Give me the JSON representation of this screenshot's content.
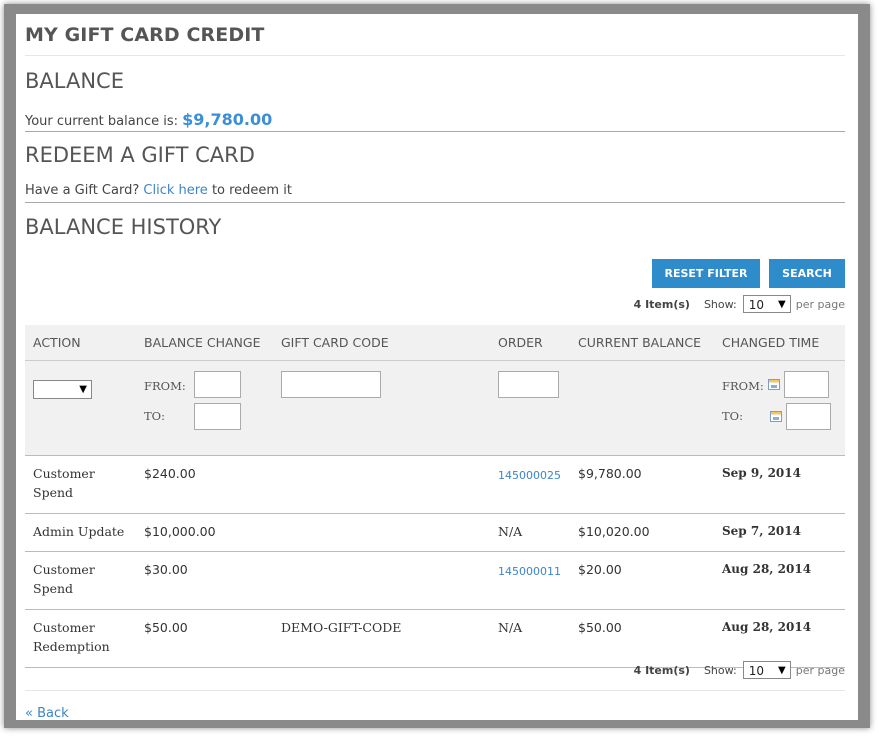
{
  "page_title": "MY GIFT CARD CREDIT",
  "balance": {
    "heading": "BALANCE",
    "text": "Your current balance is:",
    "amount": "$9,780.00"
  },
  "redeem": {
    "heading": "REDEEM A GIFT CARD",
    "prefix": "Have a Gift Card?",
    "link": "Click here",
    "suffix": "to redeem it"
  },
  "history": {
    "heading": "BALANCE HISTORY",
    "reset_filter": "RESET FILTER",
    "search": "SEARCH",
    "items_count": "4 Item(s)",
    "show_label": "Show:",
    "per_page_value": "10",
    "per_page_label": "per page",
    "columns": [
      "ACTION",
      "BALANCE CHANGE",
      "GIFT CARD CODE",
      "ORDER",
      "CURRENT BALANCE",
      "CHANGED TIME"
    ],
    "filters": {
      "from": "FROM:",
      "to": "TO:"
    },
    "rows": [
      {
        "action_line1": "Customer",
        "action_line2": "Spend",
        "change": "$240.00",
        "code": "",
        "order": "145000025",
        "order_is_link": true,
        "current": "$9,780.00",
        "time": "Sep 9, 2014"
      },
      {
        "action_line1": "Admin Update",
        "action_line2": "",
        "change": "$10,000.00",
        "code": "",
        "order": "N/A",
        "order_is_link": false,
        "current": "$10,020.00",
        "time": "Sep 7, 2014"
      },
      {
        "action_line1": "Customer",
        "action_line2": "Spend",
        "change": "$30.00",
        "code": "",
        "order": "145000011",
        "order_is_link": true,
        "current": "$20.00",
        "time": "Aug 28, 2014"
      },
      {
        "action_line1": "Customer",
        "action_line2": "Redemption",
        "change": "$50.00",
        "code": "DEMO-GIFT-CODE",
        "order": "N/A",
        "order_is_link": false,
        "current": "$50.00",
        "time": "Aug 28, 2014"
      }
    ]
  },
  "back_link": "« Back",
  "colors": {
    "accent": "#2e8ccb",
    "link": "#3d85c6",
    "balance": "#3b8ed8",
    "header_bg": "#f1f1f1"
  },
  "icons": [
    "calendar-icon",
    "chevron-down-icon"
  ]
}
